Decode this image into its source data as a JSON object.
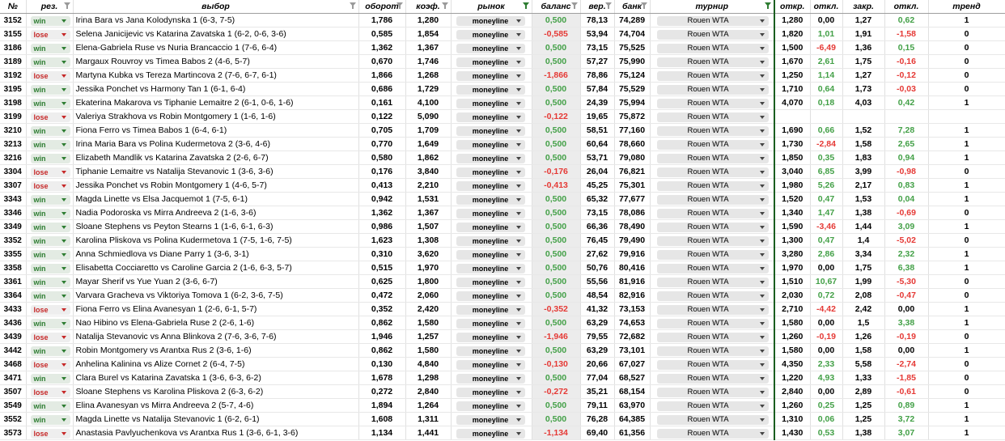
{
  "headers": {
    "id": "№",
    "res": "рез.",
    "match": "выбор",
    "turnover": "оборот",
    "odds": "коэф.",
    "market": "рынок",
    "balance": "баланс",
    "prob": "вер.",
    "bank": "банк",
    "tournament": "турнир",
    "open": "откр.",
    "dev1": "откл.",
    "close": "закр.",
    "dev2": "откл.",
    "trend": "тренд"
  },
  "colors": {
    "positive": "#43a047",
    "negative": "#e53935",
    "win": "#2e7d32",
    "lose": "#c62828"
  },
  "rows": [
    {
      "id": "3152",
      "res": "win",
      "match": "Irina Bara vs Jana Kolodynska 1 (6-3, 7-5)",
      "turnover": "1,786",
      "odds": "1,280",
      "market": "moneyline",
      "balance": "0,500",
      "prob": "78,13",
      "bank": "74,289",
      "tournament": "Rouen WTA",
      "open": "1,280",
      "dev1": "0,00",
      "close": "1,27",
      "dev2": "0,62",
      "trend": "1"
    },
    {
      "id": "3155",
      "res": "lose",
      "match": "Selena Janicijevic vs Katarina Zavatska 1 (6-2, 0-6, 3-6)",
      "turnover": "0,585",
      "odds": "1,854",
      "market": "moneyline",
      "balance": "-0,585",
      "prob": "53,94",
      "bank": "74,704",
      "tournament": "Rouen WTA",
      "open": "1,820",
      "dev1": "1,01",
      "close": "1,91",
      "dev2": "-1,58",
      "trend": "0"
    },
    {
      "id": "3186",
      "res": "win",
      "match": "Elena-Gabriela Ruse vs Nuria Brancaccio 1 (7-6, 6-4)",
      "turnover": "1,362",
      "odds": "1,367",
      "market": "moneyline",
      "balance": "0,500",
      "prob": "73,15",
      "bank": "75,525",
      "tournament": "Rouen WTA",
      "open": "1,500",
      "dev1": "-6,49",
      "close": "1,36",
      "dev2": "0,15",
      "trend": "0"
    },
    {
      "id": "3189",
      "res": "win",
      "match": "Margaux Rouvroy vs Timea Babos 2 (4-6, 5-7)",
      "turnover": "0,670",
      "odds": "1,746",
      "market": "moneyline",
      "balance": "0,500",
      "prob": "57,27",
      "bank": "75,990",
      "tournament": "Rouen WTA",
      "open": "1,670",
      "dev1": "2,61",
      "close": "1,75",
      "dev2": "-0,16",
      "trend": "0"
    },
    {
      "id": "3192",
      "res": "lose",
      "match": "Martyna Kubka vs Tereza Martincova 2 (7-6, 6-7, 6-1)",
      "turnover": "1,866",
      "odds": "1,268",
      "market": "moneyline",
      "balance": "-1,866",
      "prob": "78,86",
      "bank": "75,124",
      "tournament": "Rouen WTA",
      "open": "1,250",
      "dev1": "1,14",
      "close": "1,27",
      "dev2": "-0,12",
      "trend": "0"
    },
    {
      "id": "3195",
      "res": "win",
      "match": "Jessika Ponchet vs Harmony Tan 1 (6-1, 6-4)",
      "turnover": "0,686",
      "odds": "1,729",
      "market": "moneyline",
      "balance": "0,500",
      "prob": "57,84",
      "bank": "75,529",
      "tournament": "Rouen WTA",
      "open": "1,710",
      "dev1": "0,64",
      "close": "1,73",
      "dev2": "-0,03",
      "trend": "0"
    },
    {
      "id": "3198",
      "res": "win",
      "match": "Ekaterina Makarova vs Tiphanie Lemaitre 2 (6-1, 0-6, 1-6)",
      "turnover": "0,161",
      "odds": "4,100",
      "market": "moneyline",
      "balance": "0,500",
      "prob": "24,39",
      "bank": "75,994",
      "tournament": "Rouen WTA",
      "open": "4,070",
      "dev1": "0,18",
      "close": "4,03",
      "dev2": "0,42",
      "trend": "1"
    },
    {
      "id": "3199",
      "res": "lose",
      "match": "Valeriya Strakhova vs Robin Montgomery 1 (1-6, 1-6)",
      "turnover": "0,122",
      "odds": "5,090",
      "market": "moneyline",
      "balance": "-0,122",
      "prob": "19,65",
      "bank": "75,872",
      "tournament": "Rouen WTA",
      "open": "",
      "dev1": "",
      "close": "",
      "dev2": "",
      "trend": ""
    },
    {
      "id": "3210",
      "res": "win",
      "match": "Fiona Ferro vs Timea Babos 1 (6-4, 6-1)",
      "turnover": "0,705",
      "odds": "1,709",
      "market": "moneyline",
      "balance": "0,500",
      "prob": "58,51",
      "bank": "77,160",
      "tournament": "Rouen WTA",
      "open": "1,690",
      "dev1": "0,66",
      "close": "1,52",
      "dev2": "7,28",
      "trend": "1"
    },
    {
      "id": "3213",
      "res": "win",
      "match": "Irina Maria Bara vs Polina Kudermetova 2 (3-6, 4-6)",
      "turnover": "0,770",
      "odds": "1,649",
      "market": "moneyline",
      "balance": "0,500",
      "prob": "60,64",
      "bank": "78,660",
      "tournament": "Rouen WTA",
      "open": "1,730",
      "dev1": "-2,84",
      "close": "1,58",
      "dev2": "2,65",
      "trend": "1"
    },
    {
      "id": "3216",
      "res": "win",
      "match": "Elizabeth Mandlik vs Katarina Zavatska 2 (2-6, 6-7)",
      "turnover": "0,580",
      "odds": "1,862",
      "market": "moneyline",
      "balance": "0,500",
      "prob": "53,71",
      "bank": "79,080",
      "tournament": "Rouen WTA",
      "open": "1,850",
      "dev1": "0,35",
      "close": "1,83",
      "dev2": "0,94",
      "trend": "1"
    },
    {
      "id": "3304",
      "res": "lose",
      "match": "Tiphanie Lemaitre vs Natalija Stevanovic 1 (3-6, 3-6)",
      "turnover": "0,176",
      "odds": "3,840",
      "market": "moneyline",
      "balance": "-0,176",
      "prob": "26,04",
      "bank": "76,821",
      "tournament": "Rouen WTA",
      "open": "3,040",
      "dev1": "6,85",
      "close": "3,99",
      "dev2": "-0,98",
      "trend": "0"
    },
    {
      "id": "3307",
      "res": "lose",
      "match": "Jessika Ponchet vs Robin Montgomery 1 (4-6, 5-7)",
      "turnover": "0,413",
      "odds": "2,210",
      "market": "moneyline",
      "balance": "-0,413",
      "prob": "45,25",
      "bank": "75,301",
      "tournament": "Rouen WTA",
      "open": "1,980",
      "dev1": "5,26",
      "close": "2,17",
      "dev2": "0,83",
      "trend": "1"
    },
    {
      "id": "3343",
      "res": "win",
      "match": "Magda Linette vs Elsa Jacquemot 1 (7-5, 6-1)",
      "turnover": "0,942",
      "odds": "1,531",
      "market": "moneyline",
      "balance": "0,500",
      "prob": "65,32",
      "bank": "77,677",
      "tournament": "Rouen WTA",
      "open": "1,520",
      "dev1": "0,47",
      "close": "1,53",
      "dev2": "0,04",
      "trend": "1"
    },
    {
      "id": "3346",
      "res": "win",
      "match": "Nadia Podoroska vs Mirra Andreeva 2 (1-6, 3-6)",
      "turnover": "1,362",
      "odds": "1,367",
      "market": "moneyline",
      "balance": "0,500",
      "prob": "73,15",
      "bank": "78,086",
      "tournament": "Rouen WTA",
      "open": "1,340",
      "dev1": "1,47",
      "close": "1,38",
      "dev2": "-0,69",
      "trend": "0"
    },
    {
      "id": "3349",
      "res": "win",
      "match": "Sloane Stephens vs Peyton Stearns 1 (1-6, 6-1, 6-3)",
      "turnover": "0,986",
      "odds": "1,507",
      "market": "moneyline",
      "balance": "0,500",
      "prob": "66,36",
      "bank": "78,490",
      "tournament": "Rouen WTA",
      "open": "1,590",
      "dev1": "-3,46",
      "close": "1,44",
      "dev2": "3,09",
      "trend": "1"
    },
    {
      "id": "3352",
      "res": "win",
      "match": "Karolina Pliskova vs Polina Kudermetova 1 (7-5, 1-6, 7-5)",
      "turnover": "1,623",
      "odds": "1,308",
      "market": "moneyline",
      "balance": "0,500",
      "prob": "76,45",
      "bank": "79,490",
      "tournament": "Rouen WTA",
      "open": "1,300",
      "dev1": "0,47",
      "close": "1,4",
      "dev2": "-5,02",
      "trend": "0"
    },
    {
      "id": "3355",
      "res": "win",
      "match": "Anna Schmiedlova vs Diane Parry 1 (3-6, 3-1)",
      "turnover": "0,310",
      "odds": "3,620",
      "market": "moneyline",
      "balance": "0,500",
      "prob": "27,62",
      "bank": "79,916",
      "tournament": "Rouen WTA",
      "open": "3,280",
      "dev1": "2,86",
      "close": "3,34",
      "dev2": "2,32",
      "trend": "1"
    },
    {
      "id": "3358",
      "res": "win",
      "match": "Elisabetta Cocciaretto vs Caroline Garcia 2 (1-6, 6-3, 5-7)",
      "turnover": "0,515",
      "odds": "1,970",
      "market": "moneyline",
      "balance": "0,500",
      "prob": "50,76",
      "bank": "80,416",
      "tournament": "Rouen WTA",
      "open": "1,970",
      "dev1": "0,00",
      "close": "1,75",
      "dev2": "6,38",
      "trend": "1"
    },
    {
      "id": "3361",
      "res": "win",
      "match": "Mayar Sherif vs Yue Yuan 2 (3-6, 6-7)",
      "turnover": "0,625",
      "odds": "1,800",
      "market": "moneyline",
      "balance": "0,500",
      "prob": "55,56",
      "bank": "81,916",
      "tournament": "Rouen WTA",
      "open": "1,510",
      "dev1": "10,67",
      "close": "1,99",
      "dev2": "-5,30",
      "trend": "0"
    },
    {
      "id": "3364",
      "res": "win",
      "match": "Varvara Gracheva vs Viktoriya Tomova 1 (6-2, 3-6, 7-5)",
      "turnover": "0,472",
      "odds": "2,060",
      "market": "moneyline",
      "balance": "0,500",
      "prob": "48,54",
      "bank": "82,916",
      "tournament": "Rouen WTA",
      "open": "2,030",
      "dev1": "0,72",
      "close": "2,08",
      "dev2": "-0,47",
      "trend": "0"
    },
    {
      "id": "3433",
      "res": "lose",
      "match": "Fiona Ferro vs Elina Avanesyan 1 (2-6, 6-1, 5-7)",
      "turnover": "0,352",
      "odds": "2,420",
      "market": "moneyline",
      "balance": "-0,352",
      "prob": "41,32",
      "bank": "73,153",
      "tournament": "Rouen WTA",
      "open": "2,710",
      "dev1": "-4,42",
      "close": "2,42",
      "dev2": "0,00",
      "trend": "1"
    },
    {
      "id": "3436",
      "res": "win",
      "match": "Nao Hibino vs Elena-Gabriela Ruse 2 (2-6, 1-6)",
      "turnover": "0,862",
      "odds": "1,580",
      "market": "moneyline",
      "balance": "0,500",
      "prob": "63,29",
      "bank": "74,653",
      "tournament": "Rouen WTA",
      "open": "1,580",
      "dev1": "0,00",
      "close": "1,5",
      "dev2": "3,38",
      "trend": "1"
    },
    {
      "id": "3439",
      "res": "lose",
      "match": "Natalija Stevanovic vs Anna Blinkova 2 (7-6, 3-6, 7-6)",
      "turnover": "1,946",
      "odds": "1,257",
      "market": "moneyline",
      "balance": "-1,946",
      "prob": "79,55",
      "bank": "72,682",
      "tournament": "Rouen WTA",
      "open": "1,260",
      "dev1": "-0,19",
      "close": "1,26",
      "dev2": "-0,19",
      "trend": "0"
    },
    {
      "id": "3442",
      "res": "win",
      "match": "Robin Montgomery vs Arantxa Rus 2 (3-6, 1-6)",
      "turnover": "0,862",
      "odds": "1,580",
      "market": "moneyline",
      "balance": "0,500",
      "prob": "63,29",
      "bank": "73,101",
      "tournament": "Rouen WTA",
      "open": "1,580",
      "dev1": "0,00",
      "close": "1,58",
      "dev2": "0,00",
      "trend": "1"
    },
    {
      "id": "3468",
      "res": "lose",
      "match": "Anhelina Kalinina vs Alize Cornet 2 (6-4, 7-5)",
      "turnover": "0,130",
      "odds": "4,840",
      "market": "moneyline",
      "balance": "-0,130",
      "prob": "20,66",
      "bank": "67,027",
      "tournament": "Rouen WTA",
      "open": "4,350",
      "dev1": "2,33",
      "close": "5,58",
      "dev2": "-2,74",
      "trend": "0"
    },
    {
      "id": "3471",
      "res": "win",
      "match": "Clara Burel vs Katarina Zavatska 1 (3-6, 6-3, 6-2)",
      "turnover": "1,678",
      "odds": "1,298",
      "market": "moneyline",
      "balance": "0,500",
      "prob": "77,04",
      "bank": "68,527",
      "tournament": "Rouen WTA",
      "open": "1,220",
      "dev1": "4,93",
      "close": "1,33",
      "dev2": "-1,85",
      "trend": "0"
    },
    {
      "id": "3507",
      "res": "lose",
      "match": "Sloane Stephens vs Karolina Pliskova 2 (6-3, 6-2)",
      "turnover": "0,272",
      "odds": "2,840",
      "market": "moneyline",
      "balance": "-0,272",
      "prob": "35,21",
      "bank": "68,154",
      "tournament": "Rouen WTA",
      "open": "2,840",
      "dev1": "0,00",
      "close": "2,89",
      "dev2": "-0,61",
      "trend": "0"
    },
    {
      "id": "3549",
      "res": "win",
      "match": "Elina Avanesyan vs Mirra Andreeva 2 (5-7, 4-6)",
      "turnover": "1,894",
      "odds": "1,264",
      "market": "moneyline",
      "balance": "0,500",
      "prob": "79,11",
      "bank": "63,970",
      "tournament": "Rouen WTA",
      "open": "1,260",
      "dev1": "0,25",
      "close": "1,25",
      "dev2": "0,89",
      "trend": "1"
    },
    {
      "id": "3552",
      "res": "win",
      "match": "Magda Linette vs Natalija Stevanovic 1 (6-2, 6-1)",
      "turnover": "1,608",
      "odds": "1,311",
      "market": "moneyline",
      "balance": "0,500",
      "prob": "76,28",
      "bank": "64,385",
      "tournament": "Rouen WTA",
      "open": "1,310",
      "dev1": "0,06",
      "close": "1,25",
      "dev2": "3,72",
      "trend": "1"
    },
    {
      "id": "3573",
      "res": "lose",
      "match": "Anastasia Pavlyuchenkova vs Arantxa Rus 1 (3-6, 6-1, 3-6)",
      "turnover": "1,134",
      "odds": "1,441",
      "market": "moneyline",
      "balance": "-1,134",
      "prob": "69,40",
      "bank": "61,356",
      "tournament": "Rouen WTA",
      "open": "1,430",
      "dev1": "0,53",
      "close": "1,38",
      "dev2": "3,07",
      "trend": "1"
    }
  ]
}
